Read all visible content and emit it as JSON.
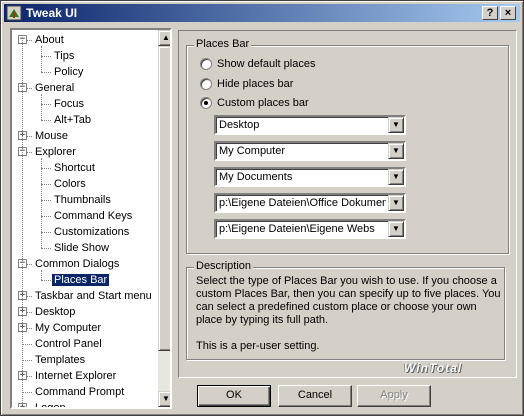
{
  "window": {
    "title": "Tweak UI",
    "help_button": "?",
    "close_button": "×"
  },
  "tree": {
    "nodes": [
      {
        "label": "About",
        "expander": "−",
        "selected": false
      },
      {
        "label": "Tips"
      },
      {
        "label": "Policy"
      },
      {
        "label": "General",
        "expander": "−"
      },
      {
        "label": "Focus"
      },
      {
        "label": "Alt+Tab"
      },
      {
        "label": "Mouse",
        "expander": "+"
      },
      {
        "label": "Explorer",
        "expander": "−"
      },
      {
        "label": "Shortcut"
      },
      {
        "label": "Colors"
      },
      {
        "label": "Thumbnails"
      },
      {
        "label": "Command Keys"
      },
      {
        "label": "Customizations"
      },
      {
        "label": "Slide Show"
      },
      {
        "label": "Common Dialogs",
        "expander": "−"
      },
      {
        "label": "Places Bar",
        "selected": true
      },
      {
        "label": "Taskbar and Start menu",
        "expander": "+"
      },
      {
        "label": "Desktop",
        "expander": "+"
      },
      {
        "label": "My Computer",
        "expander": "+"
      },
      {
        "label": "Control Panel"
      },
      {
        "label": "Templates"
      },
      {
        "label": "Internet Explorer",
        "expander": "+"
      },
      {
        "label": "Command Prompt"
      },
      {
        "label": "Logon",
        "expander": "+"
      }
    ]
  },
  "places_bar": {
    "legend": "Places Bar",
    "options": [
      {
        "label": "Show default places",
        "checked": false
      },
      {
        "label": "Hide places bar",
        "checked": false
      },
      {
        "label": "Custom places bar",
        "checked": true
      }
    ],
    "combos": [
      "Desktop",
      "My Computer",
      "My Documents",
      "p:\\Eigene Dateien\\Office Dokument",
      "p:\\Eigene Dateien\\Eigene Webs"
    ]
  },
  "description": {
    "legend": "Description",
    "paragraph1": "Select the type of Places Bar you wish to use.  If you choose a custom Places Bar, then you can specify up to five places. You can select a predefined custom place or choose your own place by typing its full path.",
    "paragraph2": "This is a per-user setting."
  },
  "watermark": "WinTotal",
  "buttons": {
    "ok": "OK",
    "cancel": "Cancel",
    "apply": "Apply"
  }
}
